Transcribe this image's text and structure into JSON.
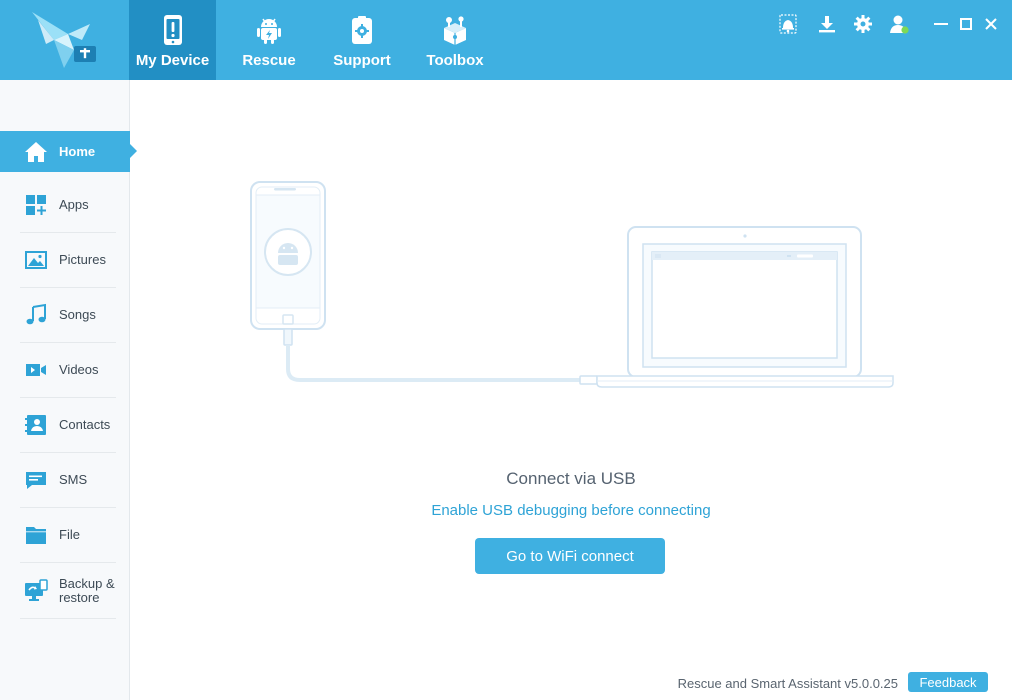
{
  "colors": {
    "brand": "#3fb0e1",
    "brand_dark": "#228fc4",
    "link": "#2ea3d6",
    "status_online": "#7ed957"
  },
  "nav": {
    "tabs": [
      {
        "label": "My Device",
        "icon": "phone-alert-icon",
        "active": true
      },
      {
        "label": "Rescue",
        "icon": "android-icon",
        "active": false
      },
      {
        "label": "Support",
        "icon": "support-gear-icon",
        "active": false
      },
      {
        "label": "Toolbox",
        "icon": "toolbox-icon",
        "active": false
      }
    ]
  },
  "window_controls": [
    "notification-icon",
    "download-icon",
    "settings-icon",
    "user-icon",
    "minimize-icon",
    "maximize-icon",
    "close-icon"
  ],
  "sidebar": {
    "items": [
      {
        "label": "Home",
        "icon": "home-icon",
        "active": true
      },
      {
        "label": "Apps",
        "icon": "apps-icon"
      },
      {
        "label": "Pictures",
        "icon": "pictures-icon"
      },
      {
        "label": "Songs",
        "icon": "music-note-icon"
      },
      {
        "label": "Videos",
        "icon": "video-camera-icon"
      },
      {
        "label": "Contacts",
        "icon": "contacts-icon"
      },
      {
        "label": "SMS",
        "icon": "sms-icon"
      },
      {
        "label": "File",
        "icon": "folder-icon"
      },
      {
        "label": "Backup & restore",
        "label_line1": "Backup &",
        "label_line2": "restore",
        "icon": "backup-icon"
      }
    ]
  },
  "main": {
    "connect_title": "Connect via USB",
    "usb_hint": "Enable USB debugging before connecting",
    "wifi_button": "Go to WiFi connect"
  },
  "footer": {
    "version": "Rescue and Smart Assistant v5.0.0.25",
    "feedback": "Feedback"
  }
}
